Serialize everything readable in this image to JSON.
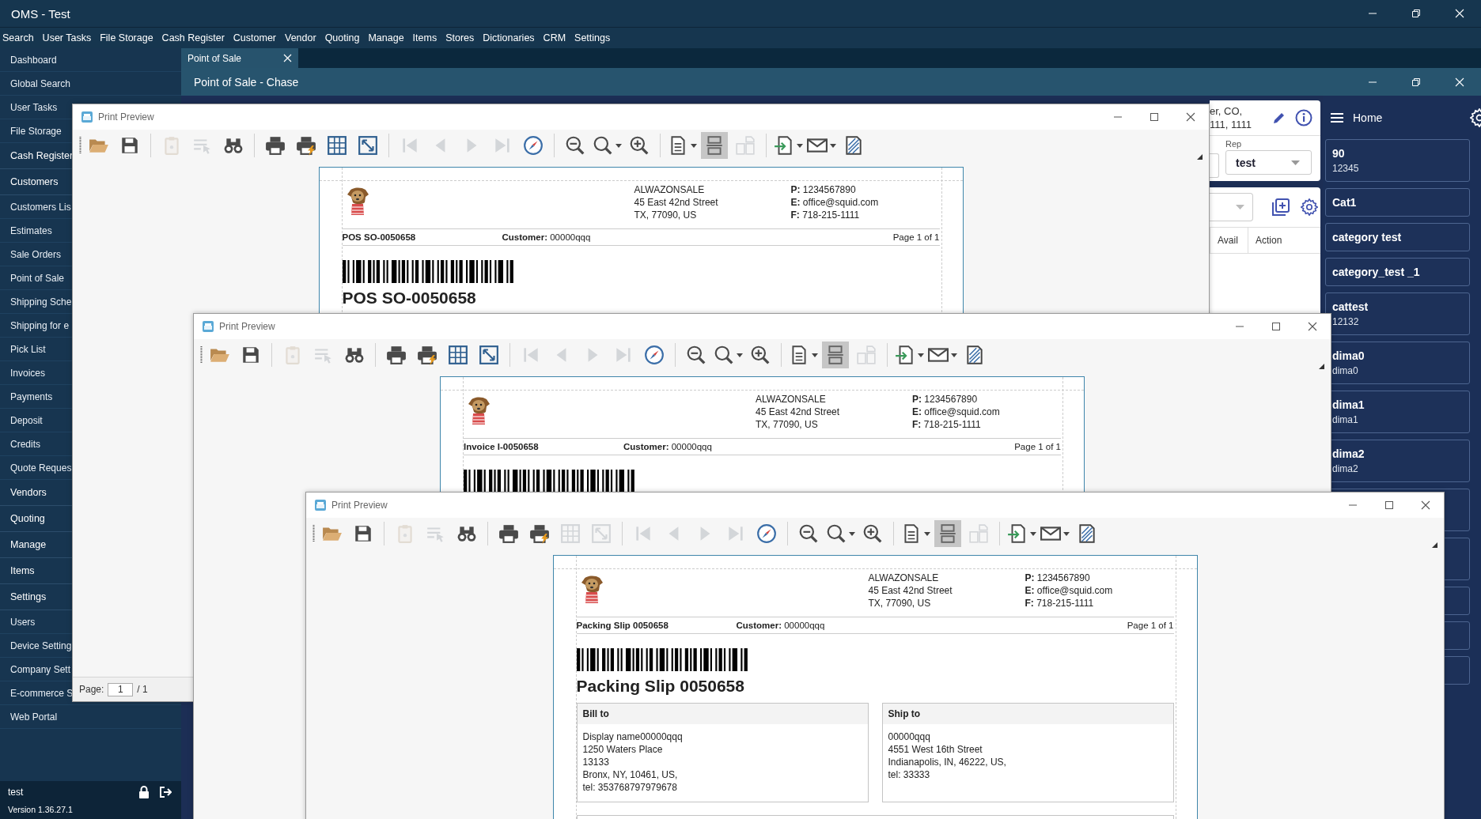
{
  "window": {
    "title": "OMS - Test"
  },
  "menu_bar": [
    "Search",
    "User Tasks",
    "File Storage",
    "Cash Register",
    "Customer",
    "Vendor",
    "Quoting",
    "Manage",
    "Items",
    "Stores",
    "Dictionaries",
    "CRM",
    "Settings"
  ],
  "sidebar": {
    "items": [
      {
        "label": "Dashboard",
        "kind": "link"
      },
      {
        "label": "Global Search",
        "kind": "link"
      },
      {
        "label": "User Tasks",
        "kind": "link"
      },
      {
        "label": "File Storage",
        "kind": "link"
      },
      {
        "label": "Cash Register",
        "kind": "group"
      },
      {
        "label": "Customers",
        "kind": "group"
      },
      {
        "label": "Customers Lis",
        "kind": "link"
      },
      {
        "label": "Estimates",
        "kind": "link"
      },
      {
        "label": "Sale Orders",
        "kind": "link"
      },
      {
        "label": "Point of Sale",
        "kind": "link"
      },
      {
        "label": "Shipping Sche",
        "kind": "link"
      },
      {
        "label": "Shipping for e",
        "kind": "link"
      },
      {
        "label": "Pick List",
        "kind": "link"
      },
      {
        "label": "Invoices",
        "kind": "link"
      },
      {
        "label": "Payments",
        "kind": "link"
      },
      {
        "label": "Deposit",
        "kind": "link"
      },
      {
        "label": "Credits",
        "kind": "link"
      },
      {
        "label": "Quote Reques",
        "kind": "link"
      },
      {
        "label": "Vendors",
        "kind": "group"
      },
      {
        "label": "Quoting",
        "kind": "group"
      },
      {
        "label": "Manage",
        "kind": "group"
      },
      {
        "label": "Items",
        "kind": "group"
      },
      {
        "label": "Settings",
        "kind": "group"
      },
      {
        "label": "Users",
        "kind": "link"
      },
      {
        "label": "Device Setting",
        "kind": "link"
      },
      {
        "label": "Company Sett",
        "kind": "link"
      },
      {
        "label": "E-commerce S",
        "kind": "link"
      },
      {
        "label": "Web Portal",
        "kind": "link"
      }
    ],
    "user": "test",
    "version": "Version 1.36.27.1"
  },
  "tabs": [
    {
      "label": "Point of Sale",
      "selected": true
    }
  ],
  "pos_window": {
    "title": "Point of Sale - Chase",
    "address_lines": [
      "er, CO,",
      "111,  1111"
    ],
    "rep_label": "Rep",
    "rep_value": "test",
    "columns": [
      "Avail",
      "Action"
    ]
  },
  "home_panel": {
    "title": "Home",
    "categories": [
      {
        "name": "90",
        "code": "12345"
      },
      {
        "name": "Cat1"
      },
      {
        "name": "category test"
      },
      {
        "name": "category_test _1"
      },
      {
        "name": "cattest",
        "code": "12132"
      },
      {
        "name": "dima0",
        "code": "dima0"
      },
      {
        "name": "dima1",
        "code": "dima1"
      },
      {
        "name": "dima2",
        "code": "dima2"
      }
    ]
  },
  "previews": [
    {
      "title": "Print Preview",
      "toolbar": [
        [
          {
            "kind": "open",
            "disabled": false,
            "pressed": false
          },
          {
            "kind": "save",
            "disabled": false,
            "pressed": false
          }
        ],
        [
          {
            "kind": "clipboard",
            "disabled": true,
            "pressed": false
          },
          {
            "kind": "select",
            "disabled": true,
            "pressed": false
          },
          {
            "kind": "find",
            "disabled": false,
            "pressed": false
          }
        ],
        [
          {
            "kind": "print",
            "disabled": false,
            "pressed": false
          },
          {
            "kind": "quick-print",
            "disabled": false,
            "pressed": false
          },
          {
            "kind": "grid",
            "disabled": false,
            "pressed": false
          },
          {
            "kind": "fit",
            "disabled": false,
            "pressed": false
          }
        ],
        [
          {
            "kind": "first",
            "disabled": true,
            "pressed": false
          },
          {
            "kind": "prev",
            "disabled": true,
            "pressed": false
          },
          {
            "kind": "next",
            "disabled": true,
            "pressed": false
          },
          {
            "kind": "last",
            "disabled": true,
            "pressed": false
          },
          {
            "kind": "navigate",
            "disabled": false,
            "pressed": false
          }
        ],
        [
          {
            "kind": "zoom-out",
            "disabled": false,
            "pressed": false
          },
          {
            "kind": "zoom",
            "disabled": false,
            "pressed": false
          },
          {
            "kind": "zoom-in",
            "disabled": false,
            "pressed": false
          }
        ],
        [
          {
            "kind": "page-setup",
            "disabled": false,
            "pressed": false
          },
          {
            "kind": "header-footer",
            "disabled": false,
            "pressed": true
          },
          {
            "kind": "multi-page",
            "disabled": true,
            "pressed": false
          }
        ],
        [
          {
            "kind": "export",
            "disabled": false,
            "pressed": false
          },
          {
            "kind": "email",
            "disabled": false,
            "pressed": false
          },
          {
            "kind": "watermark",
            "disabled": false,
            "pressed": false
          }
        ]
      ],
      "document": {
        "company": [
          "ALWAZONSALE",
          "45 East 42nd Street",
          "TX, 77090, US"
        ],
        "contacts": [
          "**P:** 1234567890",
          "**E:** office@squid.com",
          "**F:** 718-215-1111"
        ],
        "doc_number": "POS SO-0050658",
        "customer": "**Customer:** 00000qqq",
        "page": "Page 1 of 1",
        "heading": "POS SO-0050658"
      },
      "footer": {
        "label": "Page:",
        "page": "1",
        "total": "/ 1"
      }
    },
    {
      "title": "Print Preview",
      "toolbar": [
        [
          {
            "kind": "open",
            "disabled": false,
            "pressed": false
          },
          {
            "kind": "save",
            "disabled": false,
            "pressed": false
          }
        ],
        [
          {
            "kind": "clipboard",
            "disabled": true,
            "pressed": false
          },
          {
            "kind": "select",
            "disabled": true,
            "pressed": false
          },
          {
            "kind": "find",
            "disabled": false,
            "pressed": false
          }
        ],
        [
          {
            "kind": "print",
            "disabled": false,
            "pressed": false
          },
          {
            "kind": "quick-print",
            "disabled": false,
            "pressed": false
          },
          {
            "kind": "grid",
            "disabled": false,
            "pressed": false
          },
          {
            "kind": "fit",
            "disabled": false,
            "pressed": false
          }
        ],
        [
          {
            "kind": "first",
            "disabled": true,
            "pressed": false
          },
          {
            "kind": "prev",
            "disabled": true,
            "pressed": false
          },
          {
            "kind": "next",
            "disabled": true,
            "pressed": false
          },
          {
            "kind": "last",
            "disabled": true,
            "pressed": false
          },
          {
            "kind": "navigate",
            "disabled": false,
            "pressed": false
          }
        ],
        [
          {
            "kind": "zoom-out",
            "disabled": false,
            "pressed": false
          },
          {
            "kind": "zoom",
            "disabled": false,
            "pressed": false
          },
          {
            "kind": "zoom-in",
            "disabled": false,
            "pressed": false
          }
        ],
        [
          {
            "kind": "page-setup",
            "disabled": false,
            "pressed": false
          },
          {
            "kind": "header-footer",
            "disabled": false,
            "pressed": true
          },
          {
            "kind": "multi-page",
            "disabled": true,
            "pressed": false
          }
        ],
        [
          {
            "kind": "export",
            "disabled": false,
            "pressed": false
          },
          {
            "kind": "email",
            "disabled": false,
            "pressed": false
          },
          {
            "kind": "watermark",
            "disabled": false,
            "pressed": false
          }
        ]
      ],
      "document": {
        "company": [
          "ALWAZONSALE",
          "45 East 42nd Street",
          "TX, 77090, US"
        ],
        "contacts": [
          "**P:** 1234567890",
          "**E:** office@squid.com",
          "**F:** 718-215-1111"
        ],
        "doc_number": "Invoice I-0050658",
        "customer": "**Customer:** 00000qqq",
        "page": "Page 1 of 1"
      }
    },
    {
      "title": "Print Preview",
      "toolbar": [
        [
          {
            "kind": "open",
            "disabled": false,
            "pressed": false
          },
          {
            "kind": "save",
            "disabled": false,
            "pressed": false
          }
        ],
        [
          {
            "kind": "clipboard",
            "disabled": true,
            "pressed": false
          },
          {
            "kind": "select",
            "disabled": true,
            "pressed": false
          },
          {
            "kind": "find",
            "disabled": false,
            "pressed": false
          }
        ],
        [
          {
            "kind": "print",
            "disabled": false,
            "pressed": false
          },
          {
            "kind": "quick-print",
            "disabled": false,
            "pressed": false
          },
          {
            "kind": "grid",
            "disabled": true,
            "pressed": false
          },
          {
            "kind": "fit",
            "disabled": true,
            "pressed": false
          }
        ],
        [
          {
            "kind": "first",
            "disabled": true,
            "pressed": false
          },
          {
            "kind": "prev",
            "disabled": true,
            "pressed": false
          },
          {
            "kind": "next",
            "disabled": true,
            "pressed": false
          },
          {
            "kind": "last",
            "disabled": true,
            "pressed": false
          },
          {
            "kind": "navigate",
            "disabled": false,
            "pressed": false
          }
        ],
        [
          {
            "kind": "zoom-out",
            "disabled": false,
            "pressed": false
          },
          {
            "kind": "zoom",
            "disabled": false,
            "pressed": false
          },
          {
            "kind": "zoom-in",
            "disabled": false,
            "pressed": false
          }
        ],
        [
          {
            "kind": "page-setup",
            "disabled": false,
            "pressed": false
          },
          {
            "kind": "header-footer",
            "disabled": false,
            "pressed": true
          },
          {
            "kind": "multi-page",
            "disabled": true,
            "pressed": false
          }
        ],
        [
          {
            "kind": "export",
            "disabled": false,
            "pressed": false
          },
          {
            "kind": "email",
            "disabled": false,
            "pressed": false
          },
          {
            "kind": "watermark",
            "disabled": false,
            "pressed": false
          }
        ]
      ],
      "document": {
        "company": [
          "ALWAZONSALE",
          "45 East 42nd Street",
          "TX, 77090, US"
        ],
        "contacts": [
          "**P:** 1234567890",
          "**E:** office@squid.com",
          "**F:** 718-215-1111"
        ],
        "doc_number": "Packing Slip 0050658",
        "customer": "**Customer:** 00000qqq",
        "page": "Page 1 of 1",
        "heading": "Packing Slip 0050658",
        "addresses": [
          {
            "title": "Bill to",
            "lines": [
              "Display name00000qqq",
              "1250 Waters Place",
              "13133",
              "Bronx, NY, 10461, US,",
              "tel: 353768797979678"
            ]
          },
          {
            "title": "Ship to",
            "lines": [
              "00000qqq",
              "4551 West 16th Street",
              "Indianapolis, IN, 46222, US,",
              "tel: 33333"
            ]
          }
        ]
      }
    }
  ]
}
